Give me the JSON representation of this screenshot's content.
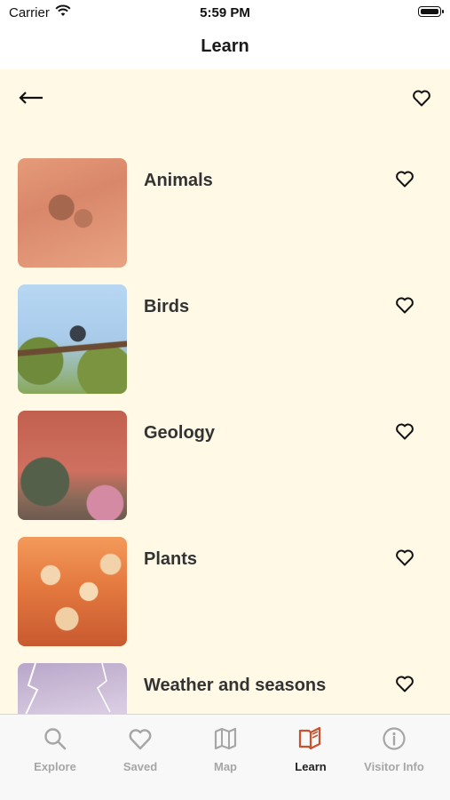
{
  "status_bar": {
    "carrier": "Carrier",
    "time": "5:59 PM"
  },
  "navbar": {
    "title": "Learn"
  },
  "categories": [
    {
      "label": "Animals"
    },
    {
      "label": "Birds"
    },
    {
      "label": "Geology"
    },
    {
      "label": "Plants"
    },
    {
      "label": "Weather and seasons"
    }
  ],
  "tab_bar": {
    "tabs": [
      {
        "label": "Explore",
        "icon": "search-icon"
      },
      {
        "label": "Saved",
        "icon": "heart-icon"
      },
      {
        "label": "Map",
        "icon": "map-icon"
      },
      {
        "label": "Learn",
        "icon": "book-icon",
        "active": true
      },
      {
        "label": "Visitor Info",
        "icon": "info-icon"
      }
    ],
    "active_color": "#c9512e",
    "inactive_color": "#a6a6a6"
  },
  "colors": {
    "content_background": "#fff9e6"
  }
}
